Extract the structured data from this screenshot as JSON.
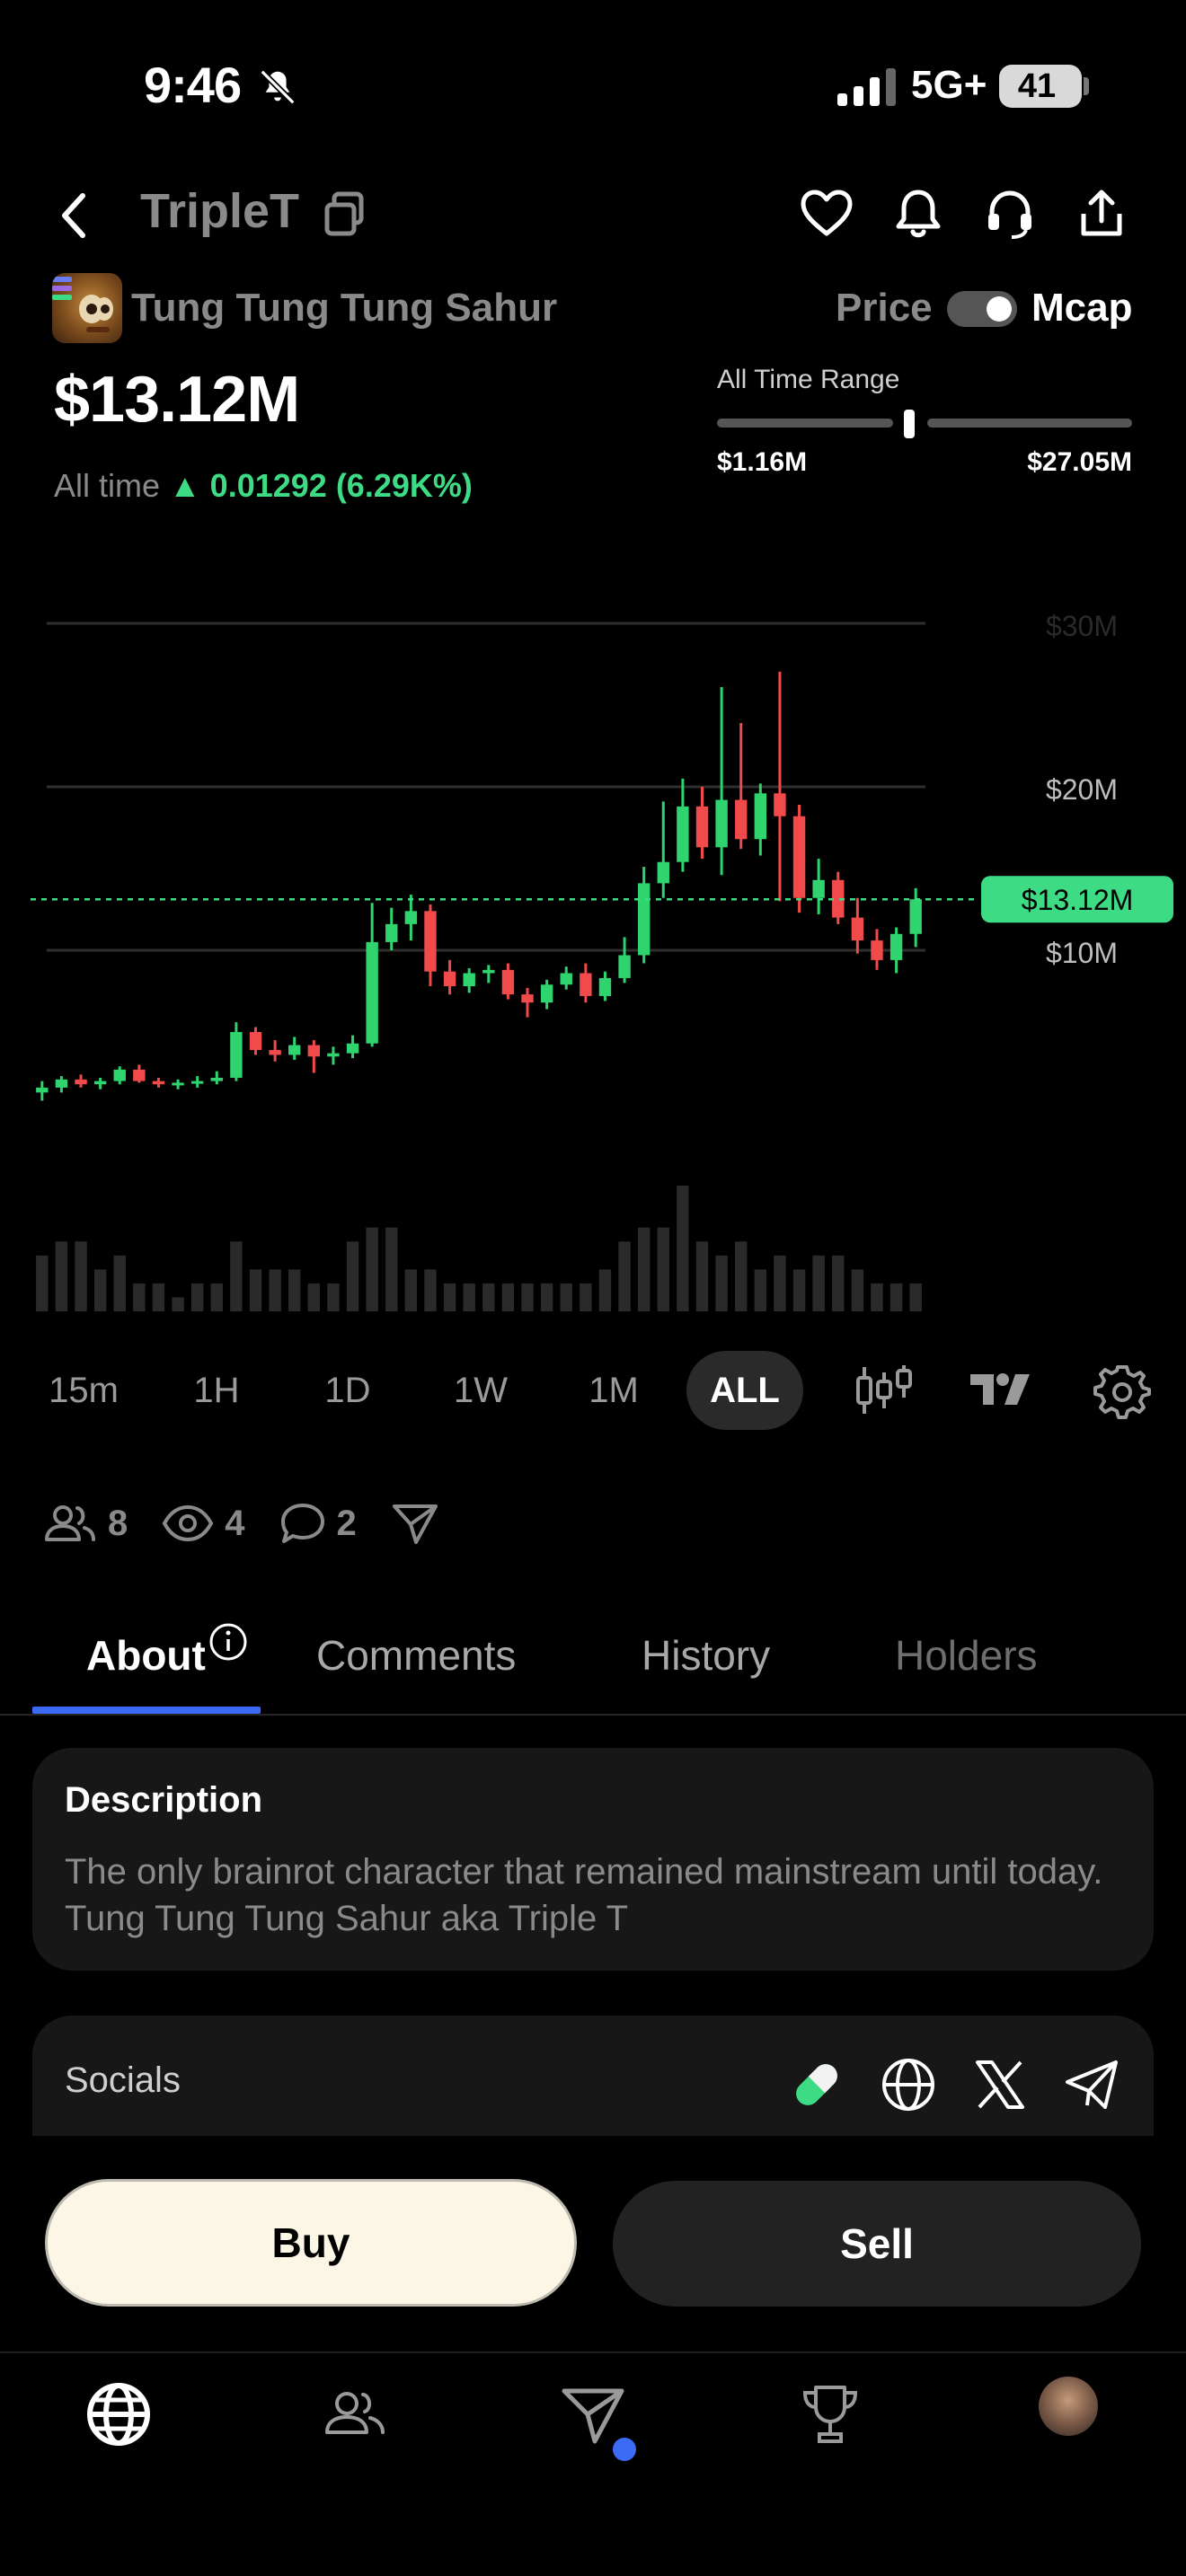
{
  "status_bar": {
    "time": "9:46",
    "network": "5G+",
    "battery": "41"
  },
  "header": {
    "ticker": "TripleT"
  },
  "token": {
    "name": "Tung Tung Tung Sahur",
    "toggle_left": "Price",
    "toggle_right": "Mcap",
    "value": "$13.12M",
    "alltime_label": "All time",
    "alltime_change": "▲ 0.01292 (6.29K%)"
  },
  "range": {
    "title": "All Time Range",
    "min": "$1.16M",
    "max": "$27.05M"
  },
  "chart_data": {
    "type": "candlestick",
    "y_axis_ticks": [
      "$30M",
      "$20M",
      "$10M"
    ],
    "current_price_label": "$13.12M",
    "current_price": 13.12,
    "ylim": [
      0,
      30
    ],
    "unit": "$M",
    "candles": [
      {
        "o": 1.3,
        "h": 2.0,
        "l": 0.8,
        "c": 1.6
      },
      {
        "o": 1.6,
        "h": 2.3,
        "l": 1.3,
        "c": 2.1
      },
      {
        "o": 2.1,
        "h": 2.4,
        "l": 1.6,
        "c": 1.8
      },
      {
        "o": 1.8,
        "h": 2.2,
        "l": 1.5,
        "c": 2.0
      },
      {
        "o": 2.0,
        "h": 2.9,
        "l": 1.8,
        "c": 2.7
      },
      {
        "o": 2.7,
        "h": 3.0,
        "l": 1.9,
        "c": 2.0
      },
      {
        "o": 2.0,
        "h": 2.2,
        "l": 1.6,
        "c": 1.8
      },
      {
        "o": 1.8,
        "h": 2.1,
        "l": 1.5,
        "c": 1.9
      },
      {
        "o": 1.9,
        "h": 2.3,
        "l": 1.6,
        "c": 2.0
      },
      {
        "o": 2.0,
        "h": 2.6,
        "l": 1.8,
        "c": 2.2
      },
      {
        "o": 2.2,
        "h": 5.6,
        "l": 2.0,
        "c": 5.0
      },
      {
        "o": 5.0,
        "h": 5.3,
        "l": 3.6,
        "c": 3.9
      },
      {
        "o": 3.9,
        "h": 4.5,
        "l": 3.2,
        "c": 3.6
      },
      {
        "o": 3.6,
        "h": 4.7,
        "l": 3.3,
        "c": 4.2
      },
      {
        "o": 4.2,
        "h": 4.5,
        "l": 2.5,
        "c": 3.5
      },
      {
        "o": 3.5,
        "h": 4.1,
        "l": 3.0,
        "c": 3.7
      },
      {
        "o": 3.7,
        "h": 4.8,
        "l": 3.4,
        "c": 4.3
      },
      {
        "o": 4.3,
        "h": 12.9,
        "l": 4.1,
        "c": 10.5
      },
      {
        "o": 10.5,
        "h": 12.6,
        "l": 10.0,
        "c": 11.6
      },
      {
        "o": 11.6,
        "h": 13.4,
        "l": 10.6,
        "c": 12.4
      },
      {
        "o": 12.4,
        "h": 12.8,
        "l": 7.8,
        "c": 8.7
      },
      {
        "o": 8.7,
        "h": 9.4,
        "l": 7.3,
        "c": 7.8
      },
      {
        "o": 7.8,
        "h": 8.9,
        "l": 7.4,
        "c": 8.6
      },
      {
        "o": 8.6,
        "h": 9.1,
        "l": 8.0,
        "c": 8.8
      },
      {
        "o": 8.8,
        "h": 9.2,
        "l": 7.0,
        "c": 7.3
      },
      {
        "o": 7.3,
        "h": 7.7,
        "l": 5.9,
        "c": 6.8
      },
      {
        "o": 6.8,
        "h": 8.2,
        "l": 6.4,
        "c": 7.9
      },
      {
        "o": 7.9,
        "h": 9.0,
        "l": 7.6,
        "c": 8.6
      },
      {
        "o": 8.6,
        "h": 9.2,
        "l": 6.8,
        "c": 7.2
      },
      {
        "o": 7.2,
        "h": 8.7,
        "l": 6.9,
        "c": 8.3
      },
      {
        "o": 8.3,
        "h": 10.8,
        "l": 8.0,
        "c": 9.7
      },
      {
        "o": 9.7,
        "h": 15.1,
        "l": 9.2,
        "c": 14.1
      },
      {
        "o": 14.1,
        "h": 19.1,
        "l": 13.2,
        "c": 15.4
      },
      {
        "o": 15.4,
        "h": 20.5,
        "l": 14.8,
        "c": 18.8
      },
      {
        "o": 18.8,
        "h": 20.0,
        "l": 15.6,
        "c": 16.3
      },
      {
        "o": 16.3,
        "h": 26.1,
        "l": 14.6,
        "c": 19.2
      },
      {
        "o": 19.2,
        "h": 23.9,
        "l": 16.2,
        "c": 16.8
      },
      {
        "o": 16.8,
        "h": 20.2,
        "l": 15.8,
        "c": 19.6
      },
      {
        "o": 19.6,
        "h": 27.05,
        "l": 13.0,
        "c": 18.2
      },
      {
        "o": 18.2,
        "h": 18.9,
        "l": 12.3,
        "c": 13.2
      },
      {
        "o": 13.2,
        "h": 15.6,
        "l": 12.2,
        "c": 14.3
      },
      {
        "o": 14.3,
        "h": 14.8,
        "l": 11.6,
        "c": 12.0
      },
      {
        "o": 12.0,
        "h": 13.2,
        "l": 9.8,
        "c": 10.6
      },
      {
        "o": 10.6,
        "h": 11.3,
        "l": 8.8,
        "c": 9.4
      },
      {
        "o": 9.4,
        "h": 11.4,
        "l": 8.6,
        "c": 11.0
      },
      {
        "o": 11.0,
        "h": 13.8,
        "l": 10.2,
        "c": 13.12
      }
    ],
    "volume": [
      4,
      5,
      5,
      3,
      4,
      2,
      2,
      1,
      2,
      2,
      5,
      3,
      3,
      3,
      2,
      2,
      5,
      6,
      6,
      3,
      3,
      2,
      2,
      2,
      2,
      2,
      2,
      2,
      2,
      3,
      5,
      6,
      6,
      9,
      5,
      4,
      5,
      3,
      4,
      3,
      4,
      4,
      3,
      2,
      2,
      2
    ]
  },
  "timeframes": [
    "15m",
    "1H",
    "1D",
    "1W",
    "1M",
    "ALL"
  ],
  "active_timeframe": "ALL",
  "stats": {
    "holders": "8",
    "views": "4",
    "comments": "2"
  },
  "tabs": [
    "About",
    "Comments",
    "History",
    "Holders"
  ],
  "description": {
    "title": "Description",
    "text": "The only brainrot character that remained mainstream until today. Tung Tung Tung Sahur aka Triple T"
  },
  "socials": {
    "label": "Socials"
  },
  "actions": {
    "buy": "Buy",
    "sell": "Sell"
  },
  "colors": {
    "up": "#2fd46e",
    "down": "#f04a4a",
    "accent": "#3b6af5",
    "price_tag": "#3ddc84"
  }
}
